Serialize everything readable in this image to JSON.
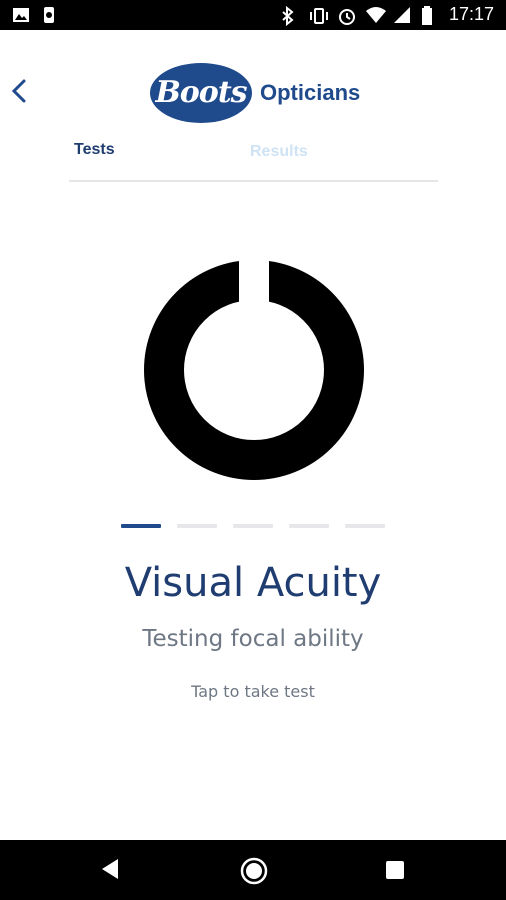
{
  "status_bar": {
    "time": "17:17",
    "icons_left": [
      "image-icon",
      "watch-icon"
    ],
    "icons_right": [
      "bluetooth-icon",
      "vibrate-icon",
      "alarm-icon",
      "wifi-icon",
      "signal-icon",
      "battery-icon"
    ]
  },
  "header": {
    "logo_text": "Boots",
    "logo_subtitle": "Opticians",
    "tabs": [
      {
        "label": "Tests",
        "active": true
      },
      {
        "label": "Results",
        "active": false
      }
    ],
    "brand_color": "#1f4a8c",
    "inactive_tab_color": "#cfe3f4"
  },
  "test": {
    "title": "Visual Acuity",
    "subtitle": "Testing focal ability",
    "action": "Tap to take test",
    "pager": {
      "count": 5,
      "active_index": 0
    }
  },
  "nav_bar": {
    "icons": [
      "back-triangle-icon",
      "home-circle-icon",
      "recents-square-icon"
    ]
  }
}
